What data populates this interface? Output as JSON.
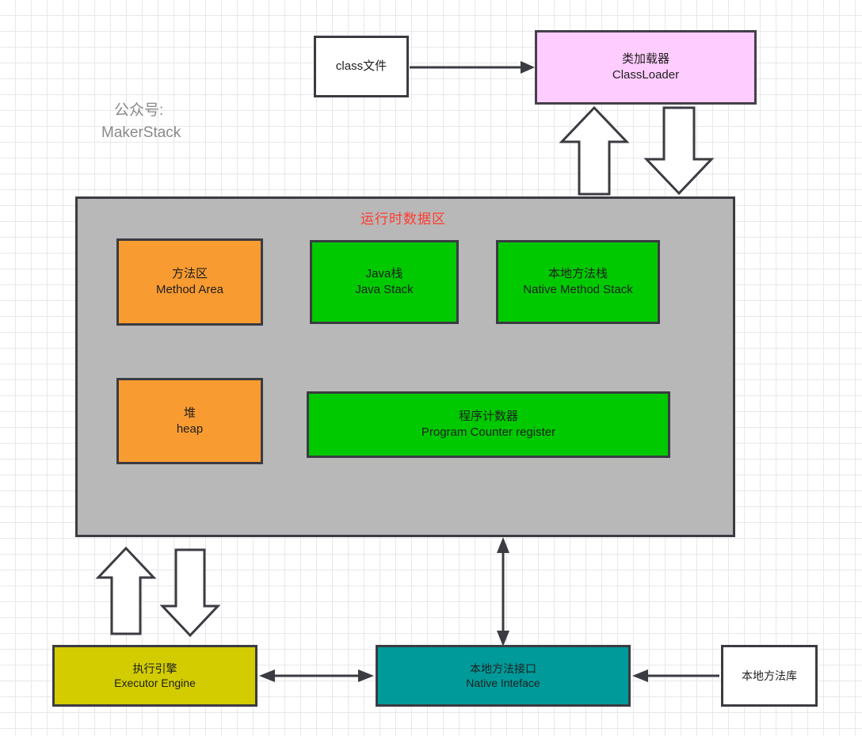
{
  "diagram": {
    "title_watermark": {
      "line1": "公众号:",
      "line2": "MakerStack"
    },
    "runtime_area_title": "运行时数据区",
    "colors": {
      "classloader": "#ffccff",
      "runtime_area": "#b8b8b8",
      "method_area": "#f89b31",
      "heap": "#f89b31",
      "java_stack": "#00c900",
      "native_method_stack": "#00c900",
      "program_counter": "#00c900",
      "executor_engine": "#d2cc00",
      "native_interface": "#009a9a",
      "class_file": "#ffffff",
      "native_library": "#ffffff",
      "title_red": "#ff3b30",
      "border": "#3b3b42"
    },
    "nodes": {
      "class_file": {
        "line1": "class文件",
        "line2": ""
      },
      "class_loader": {
        "line1": "类加载器",
        "line2": "ClassLoader"
      },
      "method_area": {
        "line1": "方法区",
        "line2": "Method Area"
      },
      "java_stack": {
        "line1": "Java栈",
        "line2": "Java Stack"
      },
      "native_method_stack": {
        "line1": "本地方法栈",
        "line2": "Native Method Stack"
      },
      "heap": {
        "line1": "堆",
        "line2": "heap"
      },
      "program_counter": {
        "line1": "程序计数器",
        "line2": "Program Counter register"
      },
      "executor_engine": {
        "line1": "执行引擎",
        "line2": "Executor Engine"
      },
      "native_interface": {
        "line1": "本地方法接口",
        "line2": "Native Inteface"
      },
      "native_library": {
        "line1": "本地方法库",
        "line2": ""
      }
    },
    "connectors": [
      {
        "name": "class-file-to-classloader",
        "kind": "thin-arrow",
        "direction": "right"
      },
      {
        "name": "runtime-to-classloader-up",
        "kind": "block-arrow",
        "direction": "up"
      },
      {
        "name": "classloader-to-runtime-down",
        "kind": "block-arrow",
        "direction": "down"
      },
      {
        "name": "executor-to-runtime-up",
        "kind": "block-arrow",
        "direction": "up"
      },
      {
        "name": "runtime-to-executor-down",
        "kind": "block-arrow",
        "direction": "down"
      },
      {
        "name": "runtime-to-native-interface",
        "kind": "thin-arrow",
        "direction": "both-vertical"
      },
      {
        "name": "executor-to-native-interface",
        "kind": "thin-arrow",
        "direction": "both-horizontal"
      },
      {
        "name": "native-library-to-native-interface",
        "kind": "thin-arrow",
        "direction": "left"
      }
    ]
  }
}
